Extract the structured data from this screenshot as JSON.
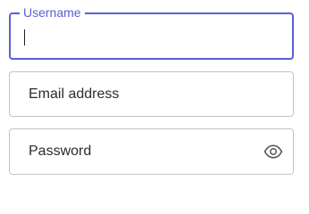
{
  "form": {
    "username": {
      "label": "Username",
      "value": "",
      "focused": true
    },
    "email": {
      "placeholder": "Email address",
      "value": ""
    },
    "password": {
      "placeholder": "Password",
      "value": "",
      "icon": "eye-icon"
    }
  },
  "colors": {
    "accent": "#5a5fd1",
    "border": "#c4c4c4",
    "text": "#2b2b2b"
  }
}
